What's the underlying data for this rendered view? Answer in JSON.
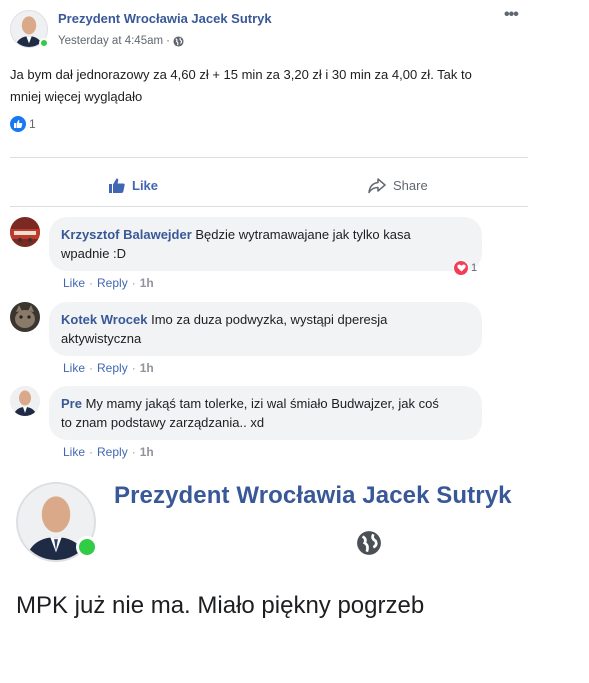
{
  "post": {
    "author": "Prezydent Wrocławia Jacek Sutryk",
    "timestamp": "Yesterday at 4:45am",
    "separator": "·",
    "privacy_icon": "globe-icon",
    "more_icon": "•••",
    "text_line1": "Ja bym dał jednorazowy za 4,60 zł + 15 min za 3,20 zł i 30 min za 4,00 zł. Tak to",
    "text_line2": "mniej więcej wyglądało",
    "reaction_count": "1",
    "like_label": "Like",
    "share_label": "Share"
  },
  "comments": [
    {
      "author": "Krzysztof Balawejder",
      "text": "Będzie wytramawajane jak tylko kasa",
      "text2": "wpadnie :D",
      "like": "Like",
      "reply": "Reply",
      "time": "1h",
      "reaction_count": "1"
    },
    {
      "author": "Kotek Wrocek",
      "text": "Imo za duza podwyzka, wystąpi dperesja",
      "text2": "aktywistyczna",
      "like": "Like",
      "reply": "Reply",
      "time": "1h"
    },
    {
      "author": "Pre",
      "text": "My mamy jakąś tam tolerke, izi wal śmiało Budwajzer, jak coś",
      "text2": "to znam podstawy zarządzania.. xd",
      "like": "Like",
      "reply": "Reply",
      "time": "1h"
    }
  ],
  "zoom": {
    "author": "Prezydent Wrocławia Jacek Sutryk",
    "text": "MPK już nie ma. Miało piękny pogrzeb"
  },
  "colors": {
    "link_blue": "#385898",
    "like_blue": "#4267b2",
    "online_green": "#31cc46",
    "heart_red": "#f33e58"
  }
}
